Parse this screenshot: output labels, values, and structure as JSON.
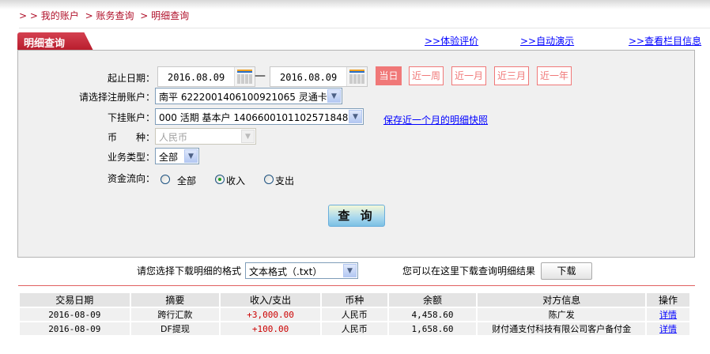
{
  "breadcrumb": {
    "items": [
      "> > 我的账户",
      "> 账务查询",
      "> 明细查询"
    ]
  },
  "tab": {
    "title": "明细查询"
  },
  "top_links": [
    ">>体验评价",
    ">>自动演示",
    ">>查看栏目信息"
  ],
  "form": {
    "date_label": "起止日期：",
    "start_date": "2016.08.09",
    "dash": "—",
    "end_date": "2016.08.09",
    "quick_ranges": [
      "当日",
      "近一周",
      "近一月",
      "近三月",
      "近一年"
    ],
    "quick_selected": "当日",
    "reg_account_label": "请选择注册账户：",
    "reg_account_value": "南平  6222001406100921065  灵通卡",
    "sub_account_label": "下挂账户：",
    "sub_account_value": "000  活期  基本户  1406600101102571848",
    "snapshot_link": "保存近一个月的明细快照",
    "currency_label": "币　　种：",
    "currency_value": "人民币",
    "biz_type_label": "业务类型：",
    "biz_type_value": "全部",
    "flow_label": "资金流向：",
    "flow_options": [
      "全部",
      "收入",
      "支出"
    ],
    "flow_selected": "收入",
    "query_button": "查 询"
  },
  "download": {
    "format_label": "请您选择下载明细的格式",
    "format_value": "文本格式（.txt）",
    "hint": "您可以在这里下载查询明细结果",
    "button": "下载"
  },
  "table": {
    "headers": [
      "交易日期",
      "摘要",
      "收入/支出",
      "币种",
      "余额",
      "对方信息",
      "操作"
    ],
    "rows": [
      [
        "2016-08-09",
        "跨行汇款",
        "+3,000.00",
        "人民币",
        "4,458.60",
        "陈广发",
        "详情"
      ],
      [
        "2016-08-09",
        "DF提现",
        "+100.00",
        "人民币",
        "1,658.60",
        "财付通支付科技有限公司客户备付金",
        "详情"
      ]
    ]
  },
  "colors": {
    "brand_red": "#b81c2c",
    "quick_button": "#f07878",
    "link": "#0000ff",
    "amount": "#cc0000"
  }
}
